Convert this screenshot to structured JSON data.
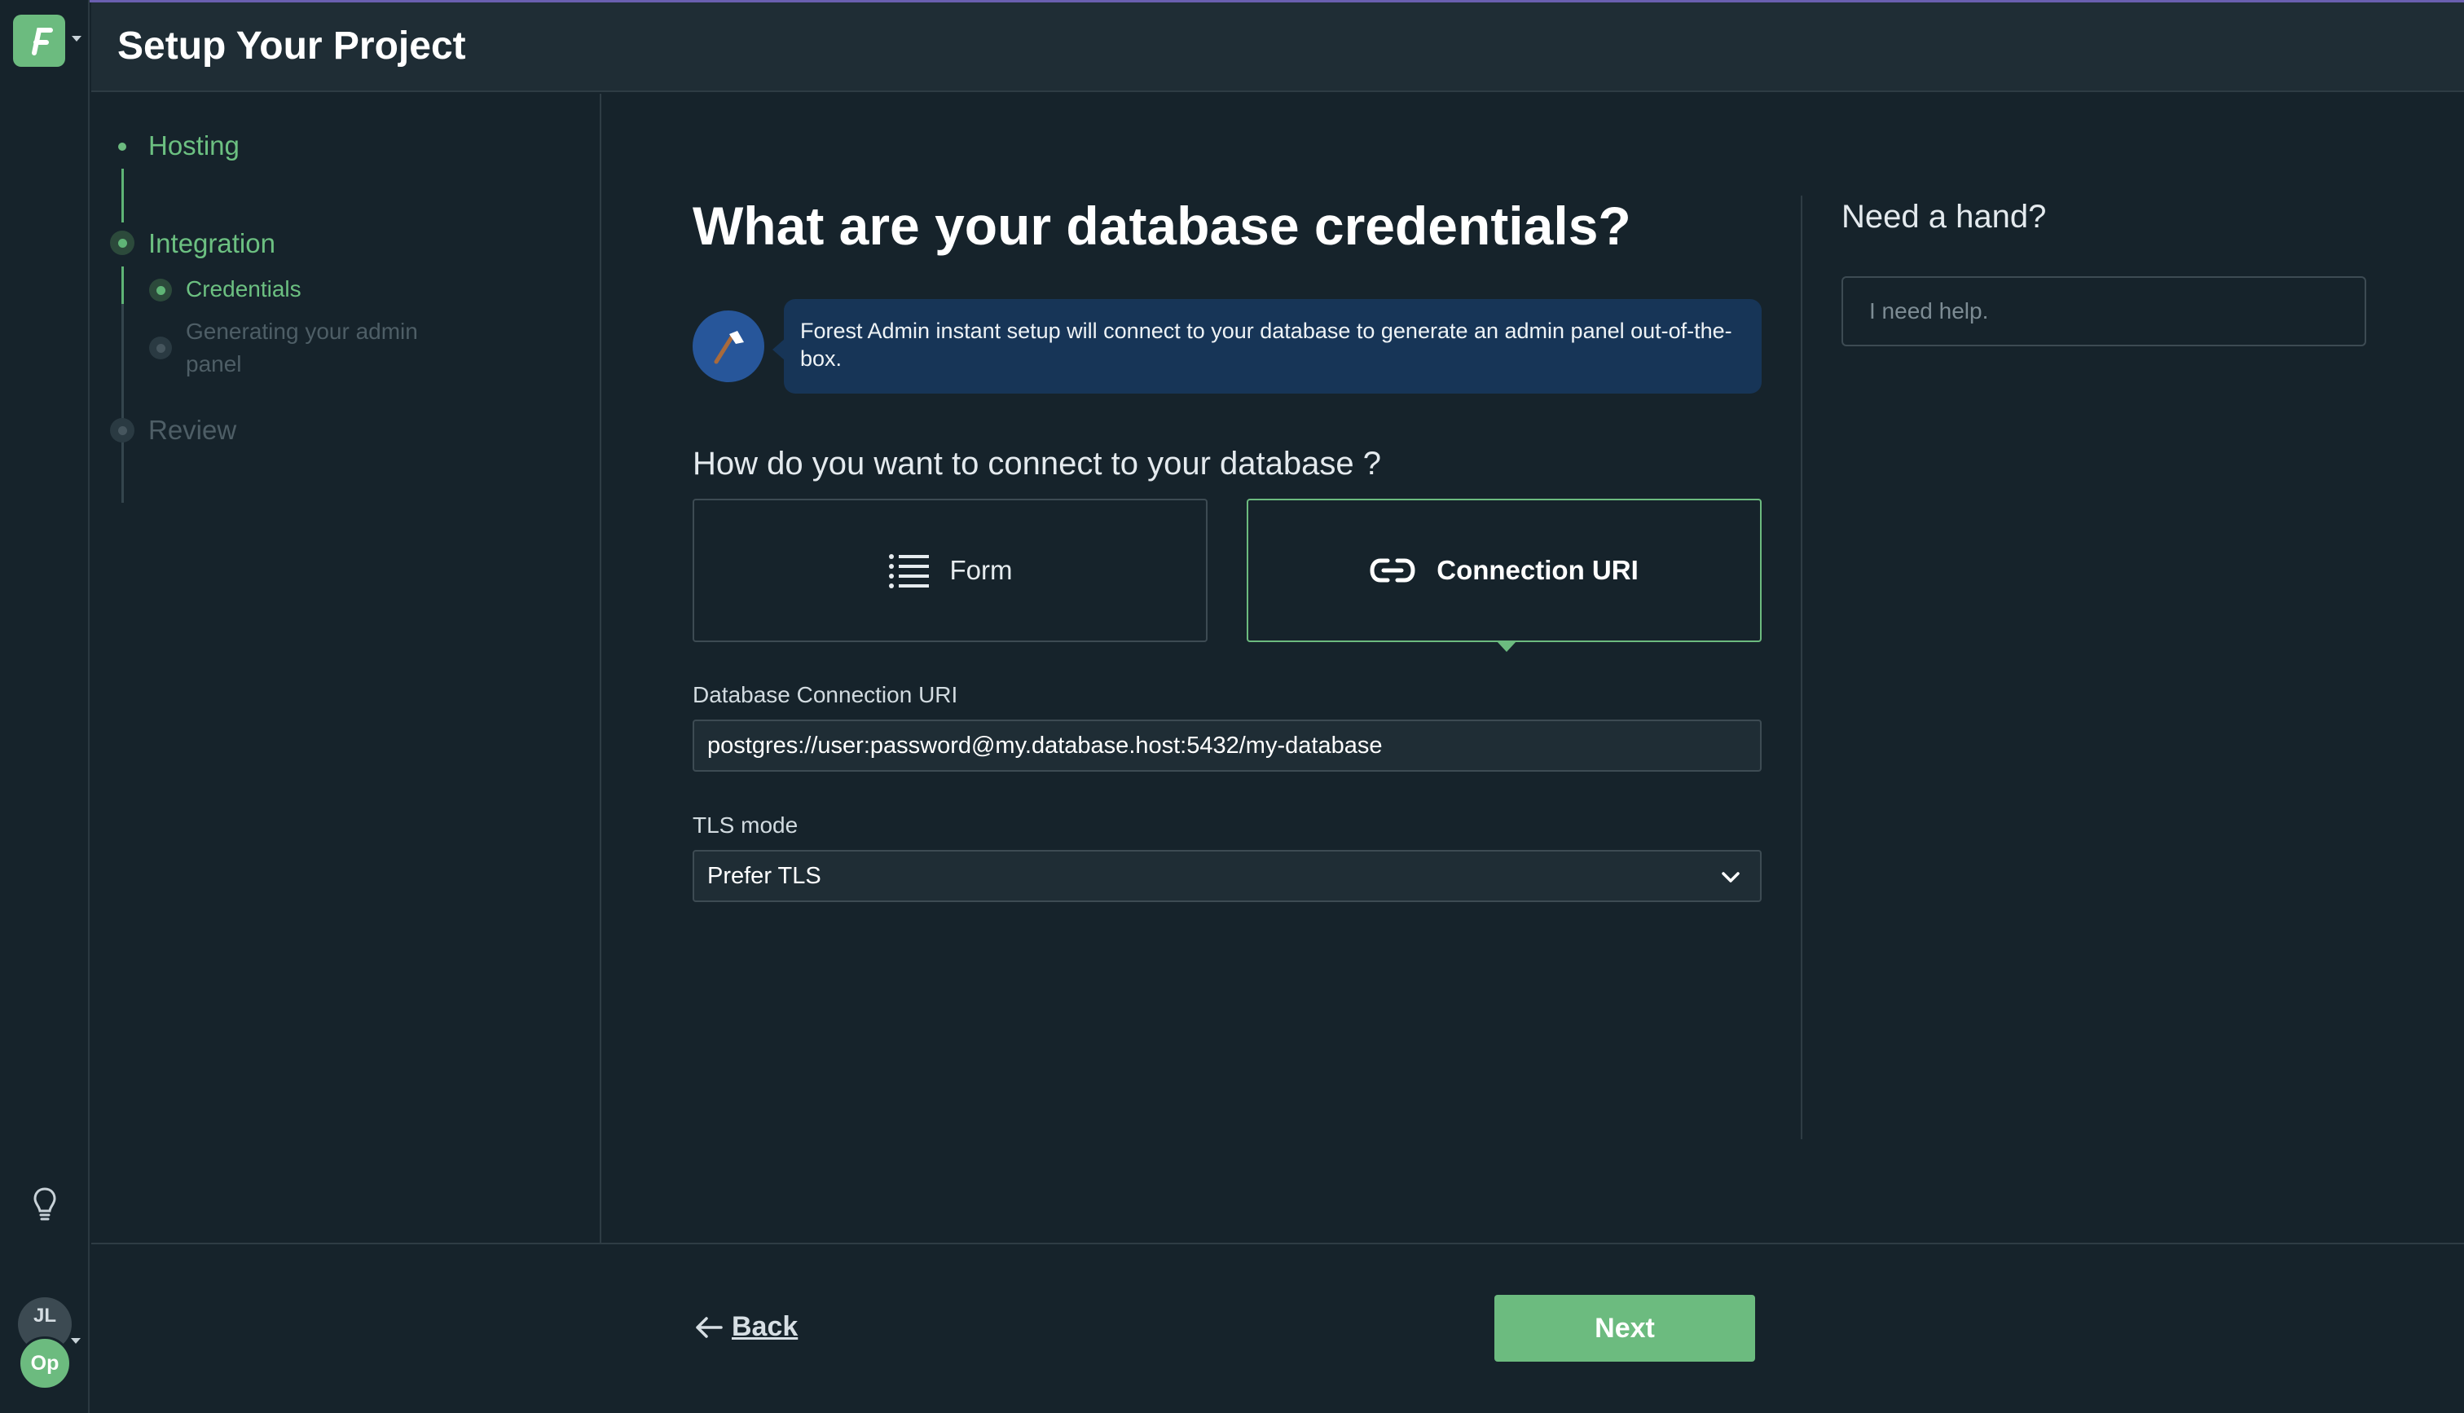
{
  "app": {
    "logo_letter": "F",
    "accent_color": "#6cbb7f",
    "user_initials": "JL",
    "project_initials": "Op"
  },
  "header": {
    "title": "Setup Your Project"
  },
  "steps": [
    {
      "label": "Hosting",
      "state": "done"
    },
    {
      "label": "Integration",
      "state": "active",
      "substeps": [
        {
          "label": "Credentials",
          "state": "active"
        },
        {
          "label": "Generating your admin\npanel",
          "state": "pending"
        }
      ]
    },
    {
      "label": "Review",
      "state": "pending"
    }
  ],
  "main": {
    "title": "What are your database credentials?",
    "hint_icon": "axe-icon",
    "hint_text": "Forest Admin instant setup will connect to your database to generate an admin panel out-of-the-box.",
    "connect_question": "How do you want to connect to your database ?",
    "options": [
      {
        "label": "Form",
        "icon": "list-icon",
        "selected": false
      },
      {
        "label": "Connection URI",
        "icon": "link-icon",
        "selected": true
      }
    ],
    "uri_label": "Database Connection URI",
    "uri_value": "postgres://user:password@my.database.host:5432/my-database",
    "tls_label": "TLS mode",
    "tls_value": "Prefer TLS"
  },
  "help": {
    "title": "Need a hand?",
    "placeholder": "I need help."
  },
  "footer": {
    "back_label": "Back",
    "next_label": "Next"
  }
}
